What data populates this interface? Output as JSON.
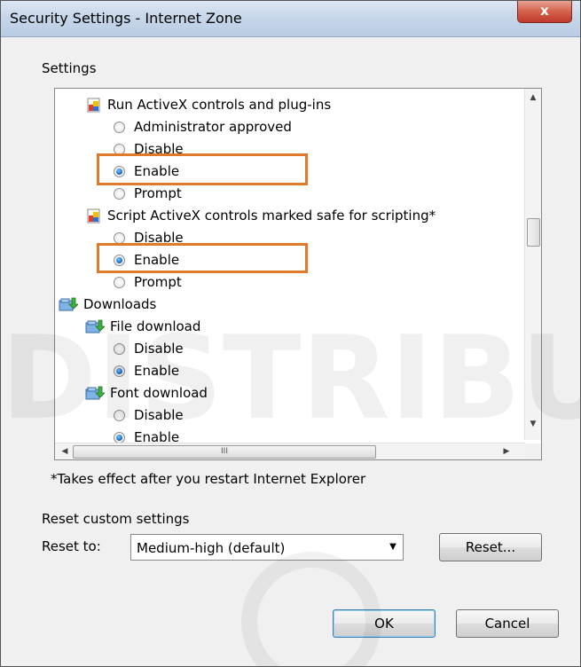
{
  "window": {
    "title": "Security Settings - Internet Zone",
    "close_glyph": "x"
  },
  "settings_group": {
    "label": "Settings"
  },
  "tree": {
    "run_activex": {
      "label": "Run ActiveX controls and plug-ins",
      "options": [
        "Administrator approved",
        "Disable",
        "Enable",
        "Prompt"
      ],
      "selected": "Enable"
    },
    "script_activex": {
      "label": "Script ActiveX controls marked safe for scripting*",
      "options": [
        "Disable",
        "Enable",
        "Prompt"
      ],
      "selected": "Enable"
    },
    "downloads": {
      "label": "Downloads"
    },
    "file_download": {
      "label": "File download",
      "options": [
        "Disable",
        "Enable"
      ],
      "selected": "Enable"
    },
    "font_download": {
      "label": "Font download",
      "options": [
        "Disable",
        "Enable"
      ],
      "selected": "Enable"
    }
  },
  "scrollbar": {
    "h_thumb_grip": "III"
  },
  "note": "*Takes effect after you restart Internet Explorer",
  "reset": {
    "group_label": "Reset custom settings",
    "reset_to_label": "Reset to:",
    "selected_level": "Medium-high (default)",
    "reset_button": "Reset..."
  },
  "buttons": {
    "ok": "OK",
    "cancel": "Cancel"
  },
  "watermark": {
    "text": "DISTRIBU"
  },
  "colors": {
    "highlight": "#e07a2a",
    "title_bar": "#c7d7ea",
    "close_button": "#c0392b"
  }
}
